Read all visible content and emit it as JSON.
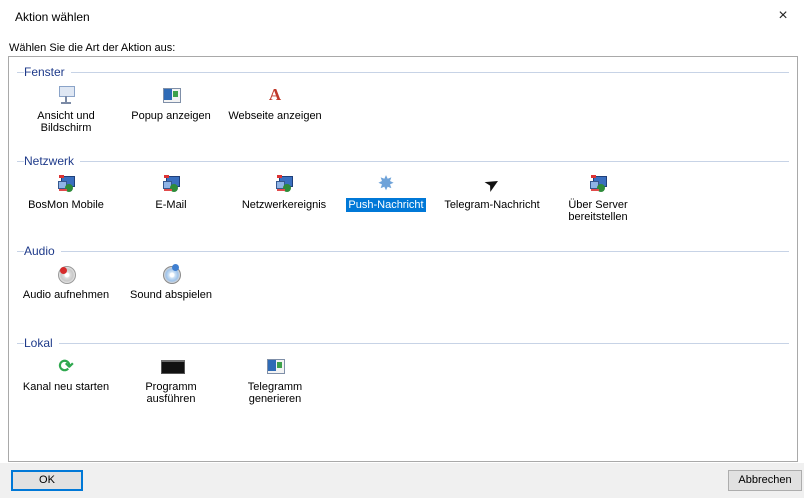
{
  "window": {
    "title": "Aktion wählen",
    "close_glyph": "×"
  },
  "prompt": "Wählen Sie die Art der Aktion aus:",
  "groups": [
    {
      "label": "Fenster",
      "items": [
        {
          "label_lines": [
            "Ansicht und",
            "Bildschirm"
          ],
          "icon": "projector-icon"
        },
        {
          "label_lines": [
            "Popup anzeigen"
          ],
          "icon": "popup-window-icon"
        },
        {
          "label_lines": [
            "Webseite anzeigen"
          ],
          "icon": "web-letter-a-icon"
        }
      ]
    },
    {
      "label": "Netzwerk",
      "items": [
        {
          "label_lines": [
            "BosMon Mobile"
          ],
          "icon": "network-computer-icon"
        },
        {
          "label_lines": [
            "E-Mail"
          ],
          "icon": "network-computer-icon"
        },
        {
          "label_lines": [
            "Netzwerkereignis"
          ],
          "icon": "network-computer-icon"
        },
        {
          "label_lines": [
            "Push-Nachricht"
          ],
          "icon": "gear-icon",
          "selected": true
        },
        {
          "label_lines": [
            "Telegram-Nachricht"
          ],
          "icon": "paper-plane-icon"
        },
        {
          "label_lines": [
            "Über Server",
            "bereitstellen"
          ],
          "icon": "network-computer-icon"
        }
      ]
    },
    {
      "label": "Audio",
      "items": [
        {
          "label_lines": [
            "Audio aufnehmen"
          ],
          "icon": "record-disc-icon"
        },
        {
          "label_lines": [
            "Sound abspielen"
          ],
          "icon": "play-disc-icon"
        }
      ]
    },
    {
      "label": "Lokal",
      "items": [
        {
          "label_lines": [
            "Kanal neu starten"
          ],
          "icon": "refresh-icon"
        },
        {
          "label_lines": [
            "Programm ausführen"
          ],
          "icon": "console-icon"
        },
        {
          "label_lines": [
            "Telegramm",
            "generieren"
          ],
          "icon": "popup-window-icon"
        }
      ]
    }
  ],
  "buttons": {
    "ok": "OK",
    "cancel": "Abbrechen"
  },
  "colors": {
    "group_label": "#1e3a8a",
    "selection": "#0078d7"
  }
}
